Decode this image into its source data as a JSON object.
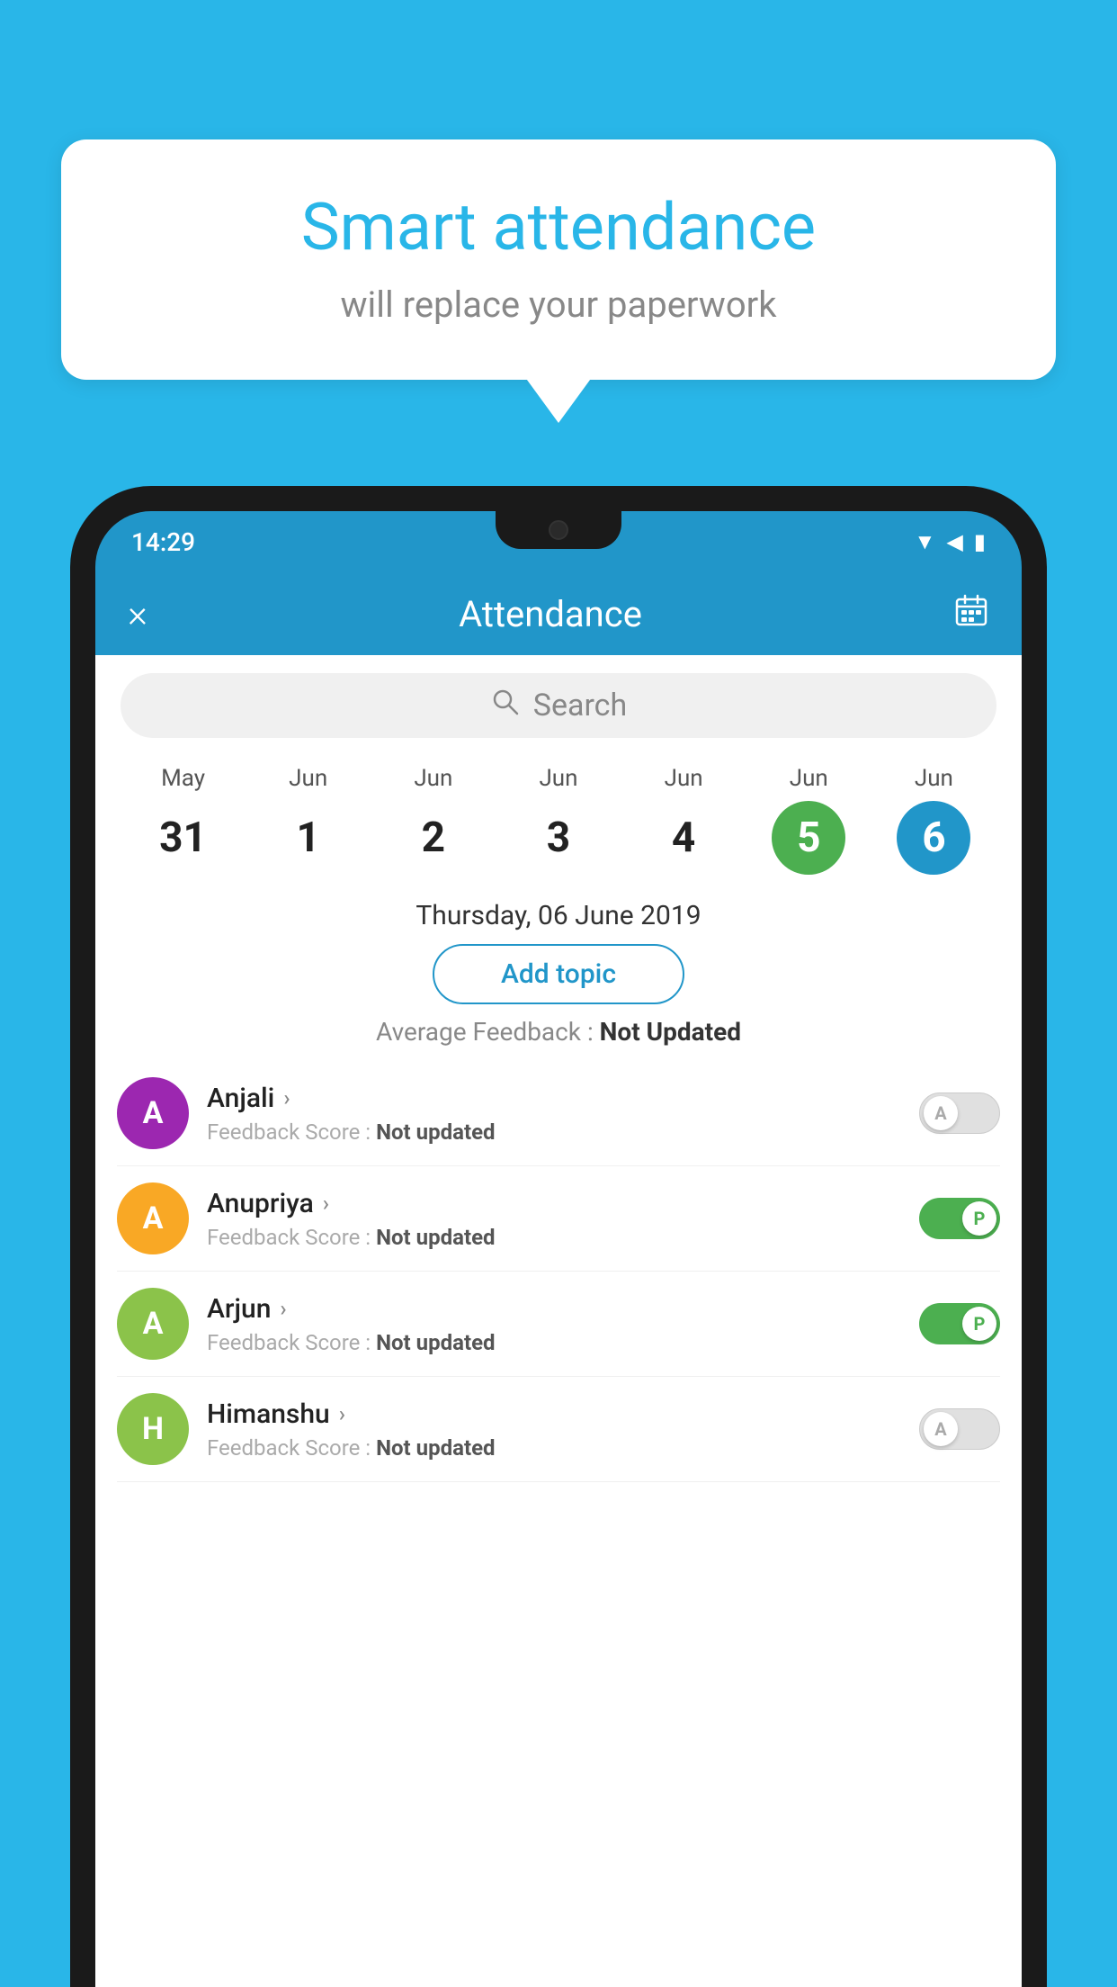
{
  "background_color": "#29b6e8",
  "speech_bubble": {
    "title": "Smart attendance",
    "subtitle": "will replace your paperwork"
  },
  "status_bar": {
    "time": "14:29",
    "icons": [
      "wifi",
      "signal",
      "battery"
    ]
  },
  "app_header": {
    "title": "Attendance",
    "close_label": "×",
    "calendar_icon": "📅"
  },
  "search": {
    "placeholder": "Search"
  },
  "calendar": {
    "days": [
      {
        "month": "May",
        "date": "31",
        "state": "normal"
      },
      {
        "month": "Jun",
        "date": "1",
        "state": "normal"
      },
      {
        "month": "Jun",
        "date": "2",
        "state": "normal"
      },
      {
        "month": "Jun",
        "date": "3",
        "state": "normal"
      },
      {
        "month": "Jun",
        "date": "4",
        "state": "normal"
      },
      {
        "month": "Jun",
        "date": "5",
        "state": "today"
      },
      {
        "month": "Jun",
        "date": "6",
        "state": "selected"
      }
    ]
  },
  "selected_date_label": "Thursday, 06 June 2019",
  "add_topic_label": "Add topic",
  "average_feedback": {
    "label": "Average Feedback : ",
    "value": "Not Updated"
  },
  "students": [
    {
      "name": "Anjali",
      "feedback_label": "Feedback Score : ",
      "feedback_value": "Not updated",
      "avatar_letter": "A",
      "avatar_color": "#9c27b0",
      "toggle": "off",
      "toggle_letter": "A"
    },
    {
      "name": "Anupriya",
      "feedback_label": "Feedback Score : ",
      "feedback_value": "Not updated",
      "avatar_letter": "A",
      "avatar_color": "#f9a825",
      "toggle": "on",
      "toggle_letter": "P"
    },
    {
      "name": "Arjun",
      "feedback_label": "Feedback Score : ",
      "feedback_value": "Not updated",
      "avatar_letter": "A",
      "avatar_color": "#8bc34a",
      "toggle": "on",
      "toggle_letter": "P"
    },
    {
      "name": "Himanshu",
      "feedback_label": "Feedback Score : ",
      "feedback_value": "Not updated",
      "avatar_letter": "H",
      "avatar_color": "#8bc34a",
      "toggle": "off",
      "toggle_letter": "A"
    }
  ]
}
